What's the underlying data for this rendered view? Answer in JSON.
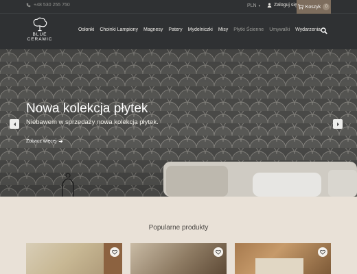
{
  "topbar": {
    "phone": "+48 530 255 750",
    "currency": "PLN",
    "login": "Zaloguj się",
    "cart_label": "Koszyk",
    "cart_count": "0"
  },
  "logo": {
    "line1": "BLUE",
    "line2": "CERAMIC"
  },
  "nav": {
    "items": [
      {
        "label": "Osłonki",
        "muted": false
      },
      {
        "label": "Choinki Lampiony",
        "muted": false
      },
      {
        "label": "Magnesy",
        "muted": false
      },
      {
        "label": "Patery",
        "muted": false
      },
      {
        "label": "Mydelniczki",
        "muted": false
      },
      {
        "label": "Misy",
        "muted": false
      },
      {
        "label": "Płytki Ścienne",
        "muted": true
      },
      {
        "label": "Umywalki",
        "muted": true
      },
      {
        "label": "Wydarzenia",
        "muted": false
      }
    ]
  },
  "hero": {
    "title": "Nowa kolekcja płytek",
    "subtitle": "Niebawem w sprzedaży nowa kolekcja płytek.",
    "link": "Zobacz więcej"
  },
  "products": {
    "title": "Popularne produkty"
  },
  "colors": {
    "header_bg": "#2f3133",
    "cart_bg": "#7d6d5d",
    "page_bg": "#e9e1d7"
  }
}
